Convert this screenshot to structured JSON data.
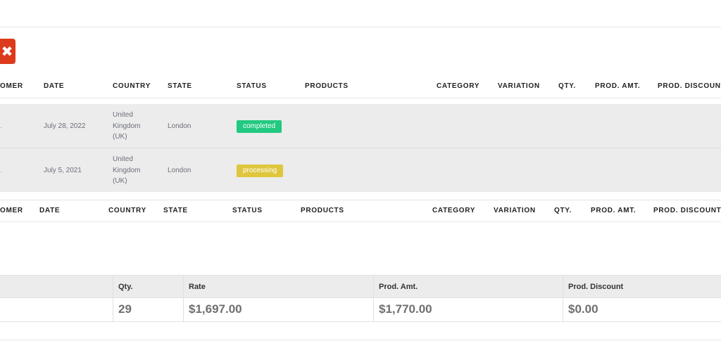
{
  "toolbar": {
    "close_icon": "close-icon",
    "close_glyph": "✖"
  },
  "table": {
    "headers": {
      "customer": "OMER",
      "date": "DATE",
      "country": "COUNTRY",
      "state": "STATE",
      "status": "STATUS",
      "products": "PRODUCTS",
      "category": "CATEGORY",
      "variation": "VARIATION",
      "qty": "QTY.",
      "prod_amt": "PROD. AMT.",
      "prod_discount": "PROD. DISCOUNT"
    },
    "rows": [
      {
        "customer_fragment": ".",
        "date": "July 28, 2022",
        "country_line1": "United",
        "country_line2": "Kingdom",
        "country_line3": "(UK)",
        "state": "London",
        "status": "completed"
      },
      {
        "customer_fragment": ".",
        "date": "July 5, 2021",
        "country_line1": "United",
        "country_line2": "Kingdom",
        "country_line3": "(UK)",
        "state": "London",
        "status": "processing"
      }
    ]
  },
  "summary": {
    "headers": {
      "qty": "Qty.",
      "rate": "Rate",
      "prod_amt": "Prod. Amt.",
      "prod_discount": "Prod. Discount"
    },
    "values": {
      "qty": "29",
      "rate": "$1,697.00",
      "prod_amt": "$1,770.00",
      "prod_discount": "$0.00"
    }
  },
  "colors": {
    "completed": "#22c980",
    "processing": "#dfc63d",
    "close_button": "#dd3a1c"
  }
}
